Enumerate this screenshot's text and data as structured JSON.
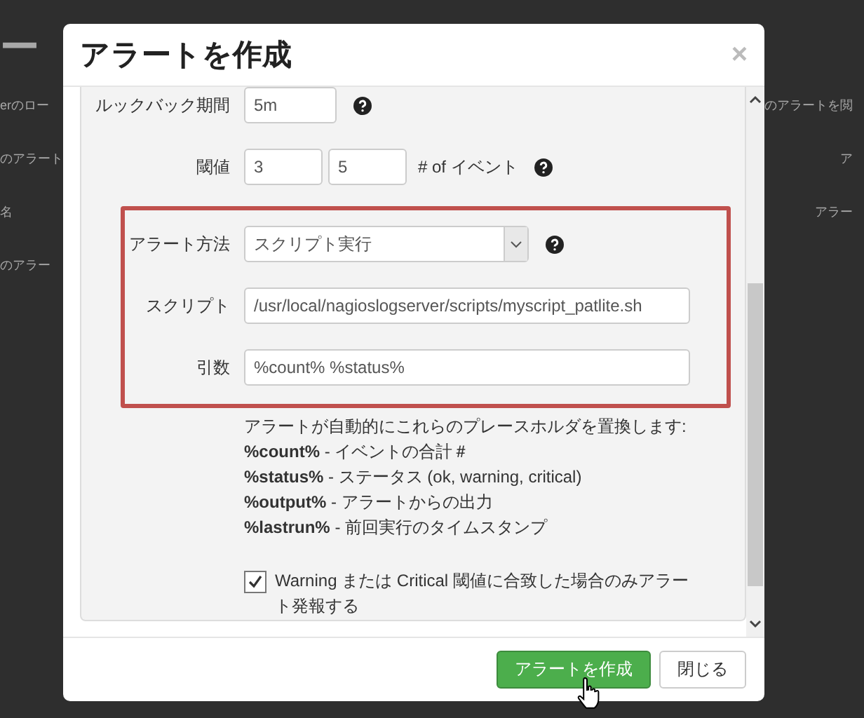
{
  "background_page": {
    "title": "ー",
    "rows": [
      {
        "left": "erのロー",
        "right": "のアラートを閲"
      },
      {
        "left": "のアラート",
        "right": "ア"
      },
      {
        "left": "名",
        "right": "アラー"
      },
      {
        "left": "のアラー",
        "right": ""
      }
    ]
  },
  "modal": {
    "title": "アラートを作成",
    "close": "×",
    "fields": [
      {
        "kind": "text",
        "label": "ルックバック期間",
        "values": [
          "5m"
        ],
        "help": true
      },
      {
        "kind": "pair",
        "label": "閾値",
        "values": [
          "3",
          "5"
        ],
        "suffix": "# of イベント",
        "help": true
      }
    ],
    "highlighted_fields": [
      {
        "kind": "select",
        "label": "アラート方法",
        "values": [
          "スクリプト実行"
        ],
        "help": true
      },
      {
        "kind": "wide",
        "label": "スクリプト",
        "values": [
          "/usr/local/nagioslogserver/scripts/myscript_patlite.sh"
        ],
        "help": false
      },
      {
        "kind": "wide",
        "label": "引数",
        "values": [
          "%count% %status%"
        ],
        "help": false
      }
    ],
    "placeholder_help": {
      "intro": "アラートが自動的にこれらのプレースホルダを置換します:",
      "items": [
        "**%count%** - イベントの合計＃",
        "**%status%** - ステータス (ok, warning, critical)",
        "**%output%** - アラートからの出力",
        "**%lastrun%** - 前回実行のタイムスタンプ"
      ]
    },
    "checkbox": {
      "label": "Warning または Critical 閾値に合致した場合のみアラート発報する",
      "checked": true
    },
    "buttons": [
      {
        "label": "アラートを作成",
        "kind": "primary"
      },
      {
        "label": "閉じる",
        "kind": "default"
      }
    ]
  }
}
